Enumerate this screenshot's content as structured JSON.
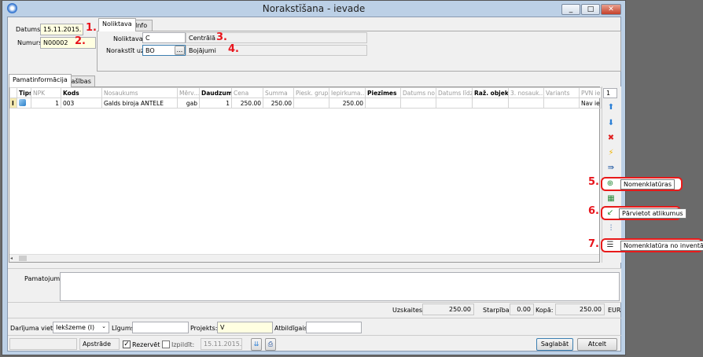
{
  "window": {
    "title": "Norakstīšana - ievade",
    "controls": [
      "_",
      "□",
      "✕"
    ]
  },
  "header": {
    "datums_label": "Datums:",
    "datums_value": "15.11.2015.",
    "numurs_label": "Numurs:",
    "numurs_value": "N00002"
  },
  "annotations": {
    "a1": "1.",
    "a2": "2.",
    "a3": "3.",
    "a4": "4.",
    "a5": "5.",
    "a6": "6.",
    "a7": "7."
  },
  "top_tabs": [
    "Noliktava",
    "Info"
  ],
  "noliktava": {
    "label": "Noliktava:",
    "code": "C",
    "name": "Centrālā",
    "norakstit_label": "Norakstīt uz:",
    "norakstit_code": "BO",
    "browse": "...",
    "norakstit_name": "Bojājumi"
  },
  "grid_tabs": [
    "Pamatinformācija",
    "Īpašības"
  ],
  "grid": {
    "columns": [
      "",
      "Tips",
      "NPK",
      "Kods",
      "Nosaukums",
      "Mērv...",
      "Daudzums",
      "Cena",
      "Summa",
      "Piesk. grupa",
      "Iepirkuma...",
      "Piezīmes",
      "Datums no",
      "Datums līdz",
      "Raž. objekts",
      "3. nosauk...",
      "Variants",
      "PVN iek"
    ],
    "rows": [
      {
        "marker": "I",
        "npk": "1",
        "kods": "003",
        "nosaukums": "Galds biroja ANTELE",
        "merv": "gab",
        "daudzums": "1",
        "cena": "250.00",
        "summa": "250.00",
        "piesk": "",
        "iepirkuma": "250.00",
        "piezimes": "",
        "datums_no": "",
        "datums_lidz": "",
        "raz": "",
        "nosauk3": "",
        "variants": "",
        "pvn": "Nav ie"
      }
    ]
  },
  "toolbar": {
    "counter": "1",
    "tooltips": {
      "nomenklaturas": "Nomenklatūras",
      "parvietot": "Pārvietot atlikumus",
      "inventars": "Nomenklatūra no inventāra"
    }
  },
  "pamatojums": {
    "label": "Pamatojums:",
    "value": ""
  },
  "totals": {
    "uzskaites_label": "Uzskaites:",
    "uzskaites": "250.00",
    "starpiba_label": "Starpība:",
    "starpiba": "0.00",
    "kopa_label": "Kopā:",
    "kopa": "250.00",
    "currency": "EUR"
  },
  "details": {
    "darijuma_label": "Darījuma vieta:",
    "darijuma_value": "Iekšzeme (I)",
    "ligums_label": "Līgums:",
    "ligums_value": "",
    "projekts_label": "Projekts:",
    "projekts_value": "V",
    "atbildigais_label": "Atbildīgais:",
    "atbildigais_value": ""
  },
  "footer": {
    "status_blank": "",
    "apstrade": "Apstrāde",
    "rezervet": "Rezervēt",
    "rezervet_checked": true,
    "izpildit": "Izpildīt:",
    "izpildit_checked": false,
    "izpildit_date": "15.11.2015.",
    "save": "Saglabāt",
    "cancel": "Atcelt"
  }
}
